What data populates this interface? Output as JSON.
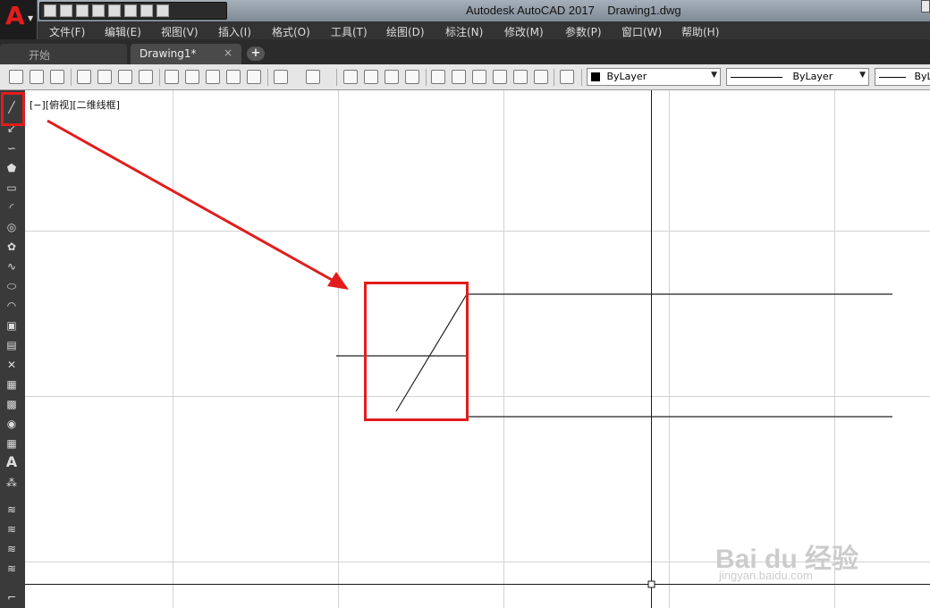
{
  "window": {
    "title": "Autodesk AutoCAD 2017    Drawing1.dwg"
  },
  "menu": [
    "文件(F)",
    "编辑(E)",
    "视图(V)",
    "插入(I)",
    "格式(O)",
    "工具(T)",
    "绘图(D)",
    "标注(N)",
    "修改(M)",
    "参数(P)",
    "窗口(W)",
    "帮助(H)"
  ],
  "tabs": {
    "start": "开始",
    "drawing": "Drawing1*",
    "close_glyph": "×",
    "add_glyph": "+"
  },
  "toolbar": {
    "color_combo": "ByLayer",
    "linetype_combo": "ByLayer",
    "lineweight_combo": "ByL"
  },
  "viewport": {
    "label": "[−][俯视][二维线框]"
  },
  "watermark": {
    "main": "Bai du 经验",
    "sub": "jingyan.baidu.com"
  },
  "colors": {
    "highlight": "#e21c1c",
    "brand": "#e31d1d",
    "canvas": "#ffffff",
    "grid": "#d0d0d0"
  },
  "icons": {
    "app": "autocad-logo-icon",
    "palette": [
      "line-tool-icon",
      "construction-line-icon",
      "polyline-icon",
      "polygon-icon",
      "rectangle-icon",
      "arc-icon",
      "circle-icon",
      "revision-cloud-icon",
      "spline-icon",
      "ellipse-icon",
      "ellipse-arc-icon",
      "insert-block-icon",
      "make-block-icon",
      "point-icon",
      "hatch-icon",
      "gradient-icon",
      "region-icon",
      "table-icon",
      "multiline-text-icon",
      "add-selected-icon"
    ]
  }
}
